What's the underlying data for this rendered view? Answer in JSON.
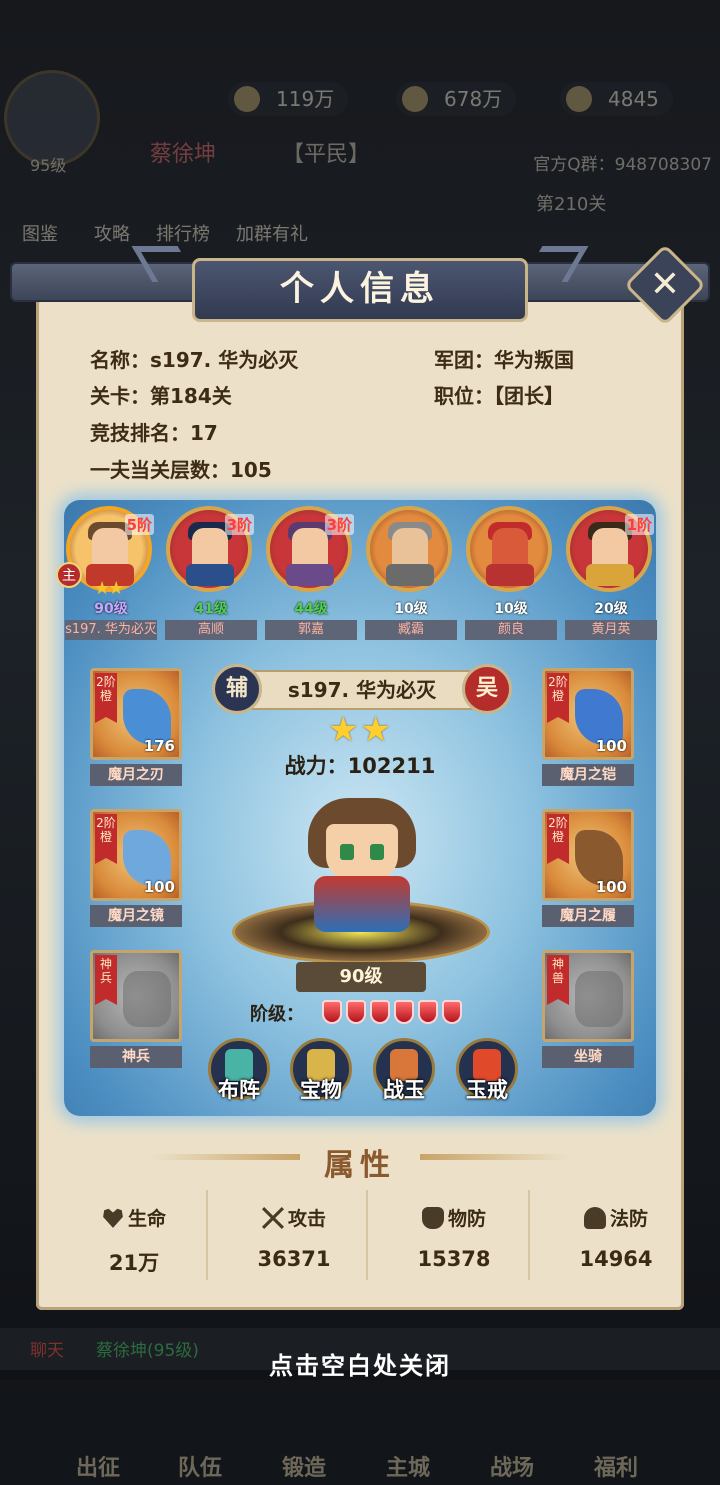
{
  "hud": {
    "level": "95级",
    "exp": "119万",
    "silver": "678万",
    "gold": "4845",
    "player_name": "蔡徐坤",
    "rank_tag": "【平民】",
    "qq_group": "官方Q群：948708307",
    "stage": "第210关",
    "menu": [
      "图鉴",
      "攻略",
      "排行榜",
      "加群有礼"
    ]
  },
  "panel": {
    "title": "个人信息",
    "close_icon": "close-x-icon"
  },
  "info": {
    "name": "名称：s197. 华为必灭",
    "legion": "军团：华为叛国",
    "stage": "关卡：第184关",
    "position": "职位：【团长】",
    "arena_rank": "竞技排名：17",
    "tower_floors": "一夫当关层数：105"
  },
  "lineup": [
    {
      "name": "s197. 华为必灭",
      "level": "90级",
      "stage": "5阶",
      "level_color": "#c9a7ff",
      "face": "#f2c9a2",
      "hair": "#6b4a2e",
      "body": "#c0392b",
      "ring": "#f5a623",
      "bg": "#f6c36a"
    },
    {
      "name": "高顺",
      "level": "41级",
      "stage": "3阶",
      "level_color": "#4fd14f",
      "face": "#f2c9a2",
      "hair": "#1b2a4a",
      "body": "#2a4f8a",
      "ring": "#d9a54b",
      "bg": "#c9363a"
    },
    {
      "name": "郭嘉",
      "level": "44级",
      "stage": "3阶",
      "level_color": "#4fd14f",
      "face": "#f2c9a2",
      "hair": "#5b3a70",
      "body": "#6b4a8a",
      "ring": "#d9a54b",
      "bg": "#c9363a"
    },
    {
      "name": "臧霸",
      "level": "10级",
      "stage": "",
      "level_color": "#ffffff",
      "face": "#e9c29a",
      "hair": "#8a8a8a",
      "body": "#6b6b6b",
      "ring": "#d9a54b",
      "bg": "#e28a3e"
    },
    {
      "name": "颜良",
      "level": "10级",
      "stage": "",
      "level_color": "#ffffff",
      "face": "#d85a3a",
      "hair": "#c22b2b",
      "body": "#b83232",
      "ring": "#d9a54b",
      "bg": "#e28a3e"
    },
    {
      "name": "黄月英",
      "level": "20级",
      "stage": "1阶",
      "level_color": "#ffffff",
      "face": "#f2c9a2",
      "hair": "#3a2a1a",
      "body": "#d9a43a",
      "ring": "#d9a54b",
      "bg": "#c9363a"
    }
  ],
  "main_badge": "主",
  "hero": {
    "left_tag": "辅",
    "name": "s197. 华为必灭",
    "faction_tag": "吴",
    "stars": "★★",
    "power": "战力：102211",
    "level": "90级",
    "rank_label": "阶级：",
    "rank_gems": 6
  },
  "equipment_left": [
    {
      "label": "魔月之刃",
      "rib": "2阶橙",
      "count": "176",
      "art_color": "#4a8fd6",
      "grey": false
    },
    {
      "label": "魔月之镜",
      "rib": "2阶橙",
      "count": "100",
      "art_color": "#6fa8dc",
      "grey": false
    },
    {
      "label": "神兵",
      "rib": "神兵",
      "count": "",
      "art_color": "#6d6d6d",
      "grey": true
    }
  ],
  "equipment_right": [
    {
      "label": "魔月之铠",
      "rib": "2阶橙",
      "count": "100",
      "art_color": "#3f7ad0",
      "grey": false
    },
    {
      "label": "魔月之履",
      "rib": "2阶橙",
      "count": "100",
      "art_color": "#8a5a2e",
      "grey": false
    },
    {
      "label": "坐骑",
      "rib": "神兽",
      "count": "",
      "art_color": "#6d6d6d",
      "grey": true
    }
  ],
  "actions": [
    {
      "label": "布阵",
      "color": "#49b3a6"
    },
    {
      "label": "宝物",
      "color": "#d9b44a"
    },
    {
      "label": "战玉",
      "color": "#d9773a"
    },
    {
      "label": "玉戒",
      "color": "#e04a2a"
    }
  ],
  "attributes": {
    "title": "属性",
    "items": [
      {
        "name": "生命",
        "value": "21万",
        "icon": "heart-icon"
      },
      {
        "name": "攻击",
        "value": "36371",
        "icon": "crossed-swords-icon"
      },
      {
        "name": "物防",
        "value": "15378",
        "icon": "armor-icon"
      },
      {
        "name": "法防",
        "value": "14964",
        "icon": "shield-mage-icon"
      }
    ]
  },
  "close_hint": "点击空白处关闭",
  "chat": {
    "tag": "聊天",
    "name": "蔡徐坤(95级)"
  },
  "bottom_nav": [
    "出征",
    "队伍",
    "锻造",
    "主城",
    "战场",
    "福利"
  ]
}
